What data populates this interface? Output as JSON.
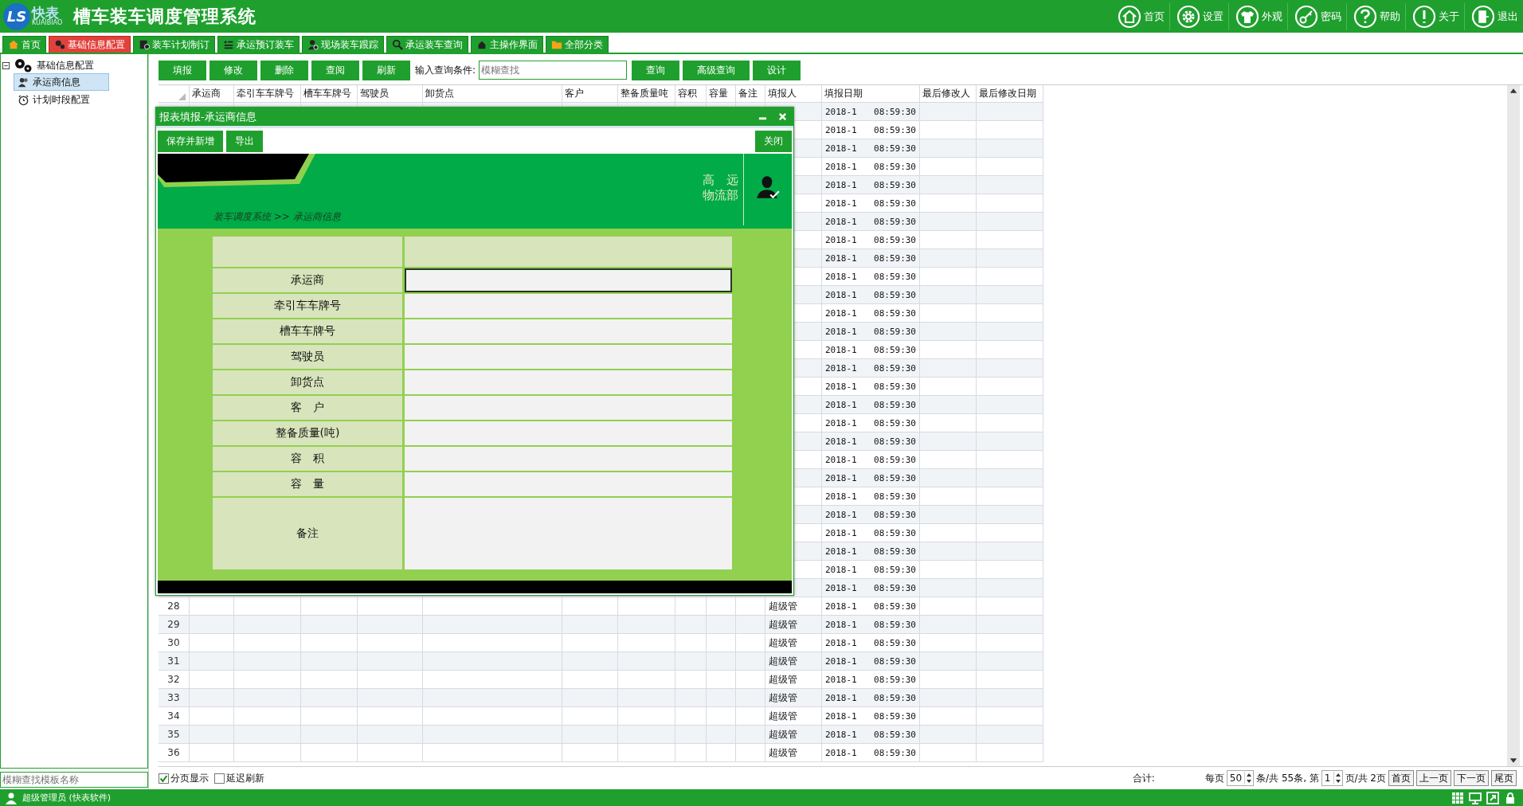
{
  "app": {
    "logo_mark": "LS",
    "logo_text": "快表",
    "logo_subtext": "KUAIBIAO",
    "title": "槽车装车调度管理系统"
  },
  "header_buttons": [
    "首页",
    "设置",
    "外观",
    "密码",
    "帮助",
    "关于",
    "退出"
  ],
  "tabs": [
    {
      "label": "首页",
      "selected": false
    },
    {
      "label": "基础信息配置",
      "selected": true
    },
    {
      "label": "装车计划制订",
      "selected": false
    },
    {
      "label": "承运预订装车",
      "selected": false
    },
    {
      "label": "现场装车跟踪",
      "selected": false
    },
    {
      "label": "承运装车查询",
      "selected": false
    },
    {
      "label": "主操作界面",
      "selected": false
    },
    {
      "label": "全部分类",
      "selected": false
    }
  ],
  "sidebar": {
    "items": [
      {
        "label": "基础信息配置",
        "expanded": true,
        "selected": false,
        "children": [
          {
            "label": "承运商信息",
            "selected": true
          },
          {
            "label": "计划时段配置",
            "selected": false
          }
        ]
      }
    ],
    "search": {
      "placeholder": "模糊查找模板名称"
    }
  },
  "toolbar": {
    "buttons": [
      "填报",
      "修改",
      "删除",
      "查阅",
      "刷新"
    ],
    "query_label": "输入查询条件:",
    "query": {
      "placeholder": "模糊查找"
    },
    "buttons_right": [
      "查询",
      "高级查询",
      "设计"
    ]
  },
  "table": {
    "columns": [
      "承运商",
      "牵引车车牌号",
      "槽车车牌号",
      "驾驶员",
      "卸货点",
      "客户",
      "整备质量吨",
      "容积",
      "容量",
      "备注",
      "填报人",
      "填报日期",
      "最后修改人",
      "最后修改日期"
    ],
    "rows": [
      {
        "date": "2018-1",
        "time": "08:59:30"
      },
      {
        "date": "2018-1",
        "time": "08:59:30"
      },
      {
        "date": "2018-1",
        "time": "08:59:30"
      },
      {
        "date": "2018-1",
        "time": "08:59:30"
      },
      {
        "date": "2018-1",
        "time": "08:59:30"
      },
      {
        "date": "2018-1",
        "time": "08:59:30"
      },
      {
        "date": "2018-1",
        "time": "08:59:30"
      },
      {
        "date": "2018-1",
        "time": "08:59:30"
      },
      {
        "date": "2018-1",
        "time": "08:59:30"
      },
      {
        "date": "2018-1",
        "time": "08:59:30"
      },
      {
        "date": "2018-1",
        "time": "08:59:30"
      },
      {
        "date": "2018-1",
        "time": "08:59:30"
      },
      {
        "date": "2018-1",
        "time": "08:59:30"
      },
      {
        "date": "2018-1",
        "time": "08:59:30"
      },
      {
        "date": "2018-1",
        "time": "08:59:30"
      },
      {
        "date": "2018-1",
        "time": "08:59:30"
      },
      {
        "date": "2018-1",
        "time": "08:59:30"
      },
      {
        "date": "2018-1",
        "time": "08:59:30"
      },
      {
        "date": "2018-1",
        "time": "08:59:30"
      },
      {
        "date": "2018-1",
        "time": "08:59:30"
      },
      {
        "date": "2018-1",
        "time": "08:59:30"
      },
      {
        "date": "2018-1",
        "time": "08:59:30"
      },
      {
        "date": "2018-1",
        "time": "08:59:30"
      },
      {
        "date": "2018-1",
        "time": "08:59:30"
      },
      {
        "date": "2018-1",
        "time": "08:59:30"
      },
      {
        "date": "2018-1",
        "time": "08:59:30"
      },
      {
        "date": "2018-1",
        "time": "08:59:30"
      },
      {
        "number": "28",
        "reporter": "超级管",
        "date": "2018-1",
        "time": "08:59:30"
      },
      {
        "number": "29",
        "reporter": "超级管",
        "date": "2018-1",
        "time": "08:59:30"
      },
      {
        "number": "30",
        "reporter": "超级管",
        "date": "2018-1",
        "time": "08:59:30"
      },
      {
        "number": "31",
        "reporter": "超级管",
        "date": "2018-1",
        "time": "08:59:30"
      },
      {
        "number": "32",
        "reporter": "超级管",
        "date": "2018-1",
        "time": "08:59:30"
      },
      {
        "number": "33",
        "reporter": "超级管",
        "date": "2018-1",
        "time": "08:59:30"
      },
      {
        "number": "34",
        "reporter": "超级管",
        "date": "2018-1",
        "time": "08:59:30"
      },
      {
        "number": "35",
        "reporter": "超级管",
        "date": "2018-1",
        "time": "08:59:30"
      },
      {
        "number": "36",
        "reporter": "超级管",
        "date": "2018-1",
        "time": "08:59:30"
      }
    ]
  },
  "dialog": {
    "title": "报表填报-承运商信息",
    "buttons": [
      "保存并新增",
      "导出"
    ],
    "close_button": "关闭",
    "company": [
      "高　远",
      "物流部"
    ],
    "breadcrumb": "装车调度系统 >> 承运商信息",
    "fields": [
      {
        "label": "承运商",
        "focused": true
      },
      {
        "label": "牵引车车牌号",
        "focused": false
      },
      {
        "label": "槽车车牌号",
        "focused": false
      },
      {
        "label": "驾驶员",
        "focused": false
      },
      {
        "label": "卸货点",
        "focused": false
      },
      {
        "label": "客　户",
        "focused": false
      },
      {
        "label": "整备质量(吨)",
        "focused": false
      },
      {
        "label": "容　积",
        "focused": false
      },
      {
        "label": "容　量",
        "focused": false
      },
      {
        "label": "备注",
        "focused": false
      }
    ]
  },
  "footer": {
    "options": [
      {
        "label": "分页显示",
        "checked": true
      },
      {
        "label": "延迟刷新",
        "checked": false
      }
    ],
    "total_label": "合计:",
    "per_page_label": "每页",
    "per_page": "50",
    "count_text": "条/共 55条, 第",
    "page": "1",
    "pages_text": "页/共 2页",
    "nav_buttons": [
      "首页",
      "上一页",
      "下一页",
      "尾页"
    ]
  },
  "status_bar": {
    "user": "超级管理员 (快表软件)"
  }
}
